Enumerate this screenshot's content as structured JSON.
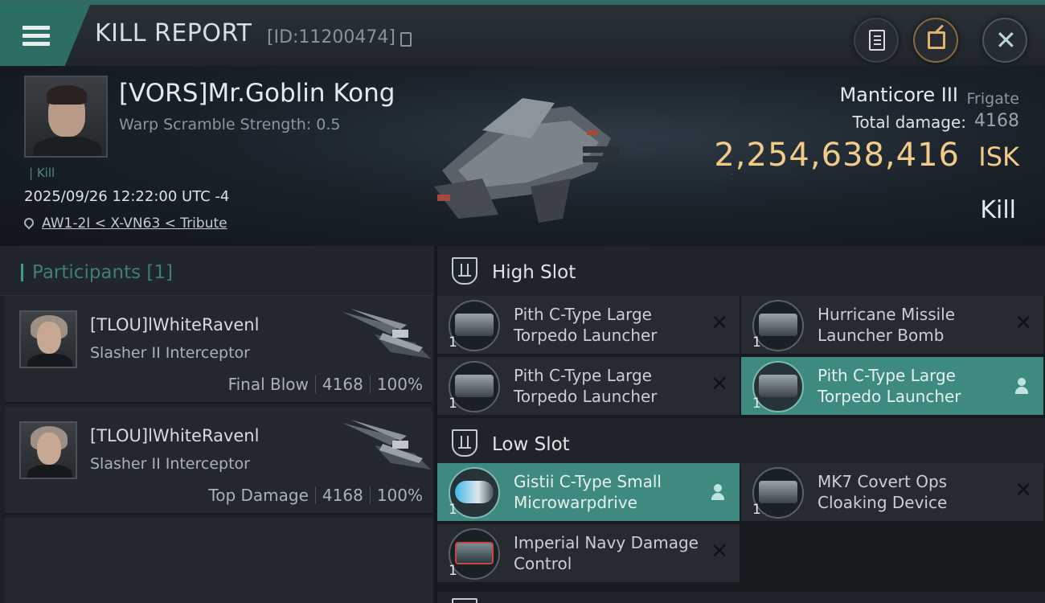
{
  "header": {
    "title": "KILL REPORT",
    "report_id": "[ID:11200474]"
  },
  "victim": {
    "name": "[VORS]Mr.Goblin Kong",
    "warp_scramble": "Warp Scramble Strength: 0.5",
    "kill_tag": "Kill",
    "timestamp": "2025/09/26 12:22:00 UTC -4",
    "location": "AW1-2I < X-VN63 < Tribute",
    "ship_name": "Manticore III",
    "ship_class": "Frigate",
    "total_damage_label": "Total damage:",
    "total_damage": "4168",
    "isk_value": "2,254,638,416",
    "isk_unit": "ISK",
    "result": "Kill"
  },
  "participants": {
    "title": "Participants [1]",
    "rows": [
      {
        "name": "[TLOU]lWhiteRavenl",
        "ship": "Slasher II Interceptor",
        "role": "Final Blow",
        "damage": "4168",
        "percent": "100%"
      },
      {
        "name": "[TLOU]lWhiteRavenl",
        "ship": "Slasher II Interceptor",
        "role": "Top Damage",
        "damage": "4168",
        "percent": "100%"
      }
    ]
  },
  "fitting": {
    "high_slot": {
      "title": "High Slot",
      "modules": [
        {
          "name": "Pith C-Type Large Torpedo Launcher",
          "qty": "1",
          "state": "destroyed"
        },
        {
          "name": "Hurricane Missile Launcher Bomb",
          "qty": "1",
          "state": "destroyed"
        },
        {
          "name": "Pith C-Type Large Torpedo Launcher",
          "qty": "1",
          "state": "destroyed"
        },
        {
          "name": "Pith C-Type Large Torpedo Launcher",
          "qty": "1",
          "state": "dropped"
        }
      ]
    },
    "low_slot": {
      "title": "Low Slot",
      "modules": [
        {
          "name": "Gistii C-Type Small Microwarpdrive",
          "qty": "1",
          "state": "dropped"
        },
        {
          "name": "MK7 Covert Ops Cloaking Device",
          "qty": "1",
          "state": "destroyed"
        },
        {
          "name": "Imperial Navy Damage Control",
          "qty": "1",
          "state": "destroyed"
        }
      ]
    }
  },
  "colors": {
    "accent_teal": "#3f8a80",
    "isk_gold": "#f2cb88",
    "header_green": "#2c6d64"
  }
}
